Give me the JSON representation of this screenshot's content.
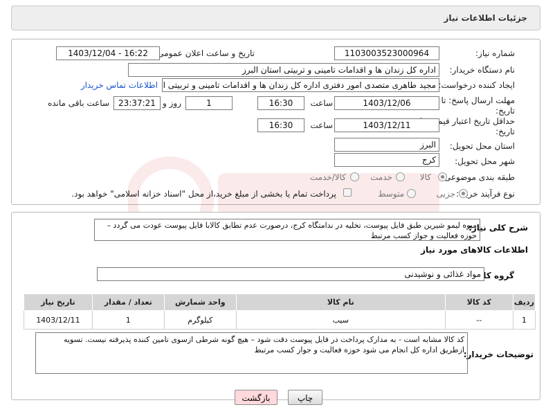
{
  "header": {
    "title": "جزئیات اطلاعات نیاز"
  },
  "form": {
    "need_number": {
      "label": "شماره نیاز:",
      "value": "1103003523000964"
    },
    "announce_datetime": {
      "label": "تاریخ و ساعت اعلان عمومی:",
      "value": "1403/12/04 - 16:22"
    },
    "buyer_org": {
      "label": "نام دستگاه خریدار:",
      "value": "اداره کل زندان ها و اقدامات تامینی و تربیتی استان البرز"
    },
    "requester": {
      "label": "ایجاد کننده درخواست:",
      "value": "مجید طاهری متصدی امور دفتری اداره کل زندان ها و اقدامات تامینی و تربیتی اس",
      "contact_link": "اطلاعات تماس خریدار"
    },
    "reply_deadline": {
      "label": "مهلت ارسال پاسخ: تا تاریخ:",
      "date": "1403/12/06",
      "time_label": "ساعت",
      "time": "16:30",
      "days": "1",
      "days_label": "روز و",
      "remaining": "23:37:21",
      "remaining_label": "ساعت باقی مانده"
    },
    "price_validity": {
      "label": "حداقل تاریخ اعتبار قیمت: تا تاریخ:",
      "date": "1403/12/11",
      "time_label": "ساعت",
      "time": "16:30"
    },
    "province": {
      "label": "استان محل تحویل:",
      "value": "البرز"
    },
    "city": {
      "label": "شهر محل تحویل:",
      "value": "کرج"
    },
    "category": {
      "label": "طبقه بندی موضوعی:",
      "options": [
        "کالا",
        "خدمت",
        "کالا/خدمت"
      ],
      "selected": "کالا"
    },
    "process_type": {
      "label": "نوع فرآیند خرید :",
      "options": [
        "جزیی",
        "متوسط"
      ],
      "selected": "جزیی",
      "note": "پرداخت تمام یا بخشی از مبلغ خرید،از محل \"اسناد خزانه اسلامی\" خواهد بود."
    }
  },
  "description": {
    "label": "شرح کلی نیاز:",
    "text": "میوه لیمو شیرین طبق فایل پیوست، تخلیه در ندامتگاه کرج، درصورت عدم تطابق کالابا فایل پیوست عودت می گردد – حوزه فعالیت و جواز کسب مرتبط"
  },
  "goods": {
    "section_title": "اطلاعات کالاهای مورد نیاز",
    "group_label": "گروه کالا:",
    "group_value": "مواد غذائی و نوشیدنی",
    "columns": [
      "ردیف",
      "کد کالا",
      "نام کالا",
      "واحد شمارش",
      "تعداد / مقدار",
      "تاریخ نیاز"
    ],
    "rows": [
      {
        "idx": "1",
        "code": "--",
        "name": "سیب",
        "unit": "کیلوگرم",
        "qty": "1",
        "date": "1403/12/11"
      }
    ]
  },
  "buyer_notes": {
    "label": "توضیحات خریدار:",
    "text": "کد کالا مشابه است - به مدارک پرداخت در فایل پیوست دقت شود – هیچ گونه شرطی ازسوی تامین کننده پذیرفته نیست. تسویه ازطریق اداره کل انجام می شود حوزه فعالیت و جواز کسب مرتبط"
  },
  "buttons": {
    "print": "چاپ",
    "back": "بازگشت"
  },
  "colors": {
    "link": "#1a56c8",
    "back_button_bg": "#ffd9dc"
  }
}
